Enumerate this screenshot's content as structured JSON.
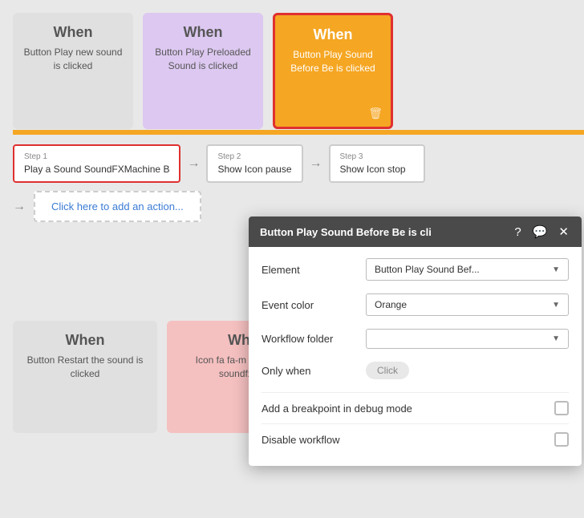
{
  "cards": {
    "top": [
      {
        "id": "card-gray",
        "style": "gray",
        "title": "When",
        "subtitle": "Button Play new sound is clicked"
      },
      {
        "id": "card-lavender",
        "style": "lavender",
        "title": "When",
        "subtitle": "Button Play Preloaded Sound is clicked"
      },
      {
        "id": "card-orange",
        "style": "orange",
        "title": "When",
        "subtitle": "Button Play Sound Before Be is clicked"
      }
    ],
    "bottom": [
      {
        "id": "card-gray-b",
        "style": "gray",
        "title": "When",
        "subtitle": "Button Restart the sound is clicked"
      },
      {
        "id": "card-pink",
        "style": "pink",
        "title": "Wh",
        "subtitle": "Icon fa fa-m sla is cli soundfx's"
      }
    ]
  },
  "steps": [
    {
      "id": "step1",
      "label": "Step 1",
      "content": "Play a Sound SoundFXMachine B",
      "highlighted": true
    },
    {
      "id": "step2",
      "label": "Step 2",
      "content": "Show Icon pause",
      "highlighted": false
    },
    {
      "id": "step3",
      "label": "Step 3",
      "content": "Show Icon stop",
      "highlighted": false
    }
  ],
  "add_action": "Click here to add an action...",
  "modal": {
    "title": "Button Play Sound Before Be is cli",
    "icons": {
      "help": "?",
      "comment": "💬",
      "close": "✕"
    },
    "fields": [
      {
        "id": "element",
        "label": "Element",
        "value": "Button Play Sound Bef...",
        "type": "dropdown"
      },
      {
        "id": "event_color",
        "label": "Event color",
        "value": "Orange",
        "type": "dropdown"
      },
      {
        "id": "workflow_folder",
        "label": "Workflow folder",
        "value": "",
        "type": "dropdown"
      }
    ],
    "only_when": {
      "label": "Only when",
      "badge": "Click"
    },
    "checkboxes": [
      {
        "id": "breakpoint",
        "label": "Add a breakpoint in debug mode"
      },
      {
        "id": "disable",
        "label": "Disable workflow"
      }
    ]
  }
}
